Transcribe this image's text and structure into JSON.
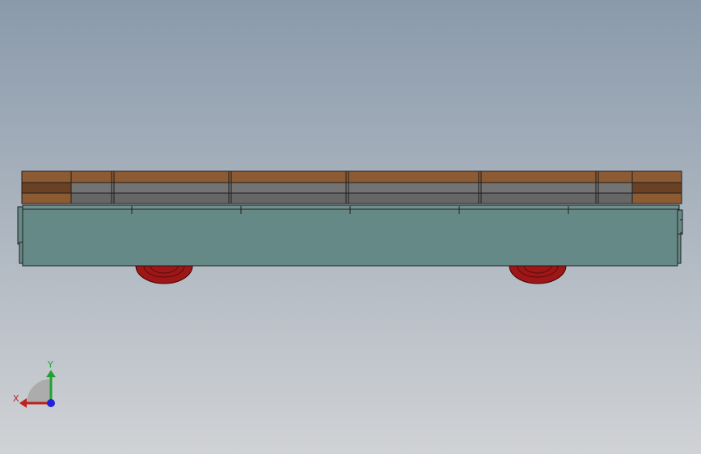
{
  "viewport": {
    "background_top": "#8a9aab",
    "background_bottom": "#d0d2d5"
  },
  "model": {
    "parts": [
      "wood-plank",
      "wood-stack",
      "steel-beam",
      "trolley-body",
      "wheel"
    ],
    "colors": {
      "wood": "#8c5a33",
      "wood_dark": "#6b4124",
      "steel": "#6d6d6d",
      "body": "#658987",
      "wheel": "#9e1616",
      "edge": "#1e1e1e"
    }
  },
  "triad": {
    "x_label": "X",
    "y_label": "Y",
    "x_color": "#c0201c",
    "y_color": "#21a133",
    "z_color": "#1f22d6"
  }
}
